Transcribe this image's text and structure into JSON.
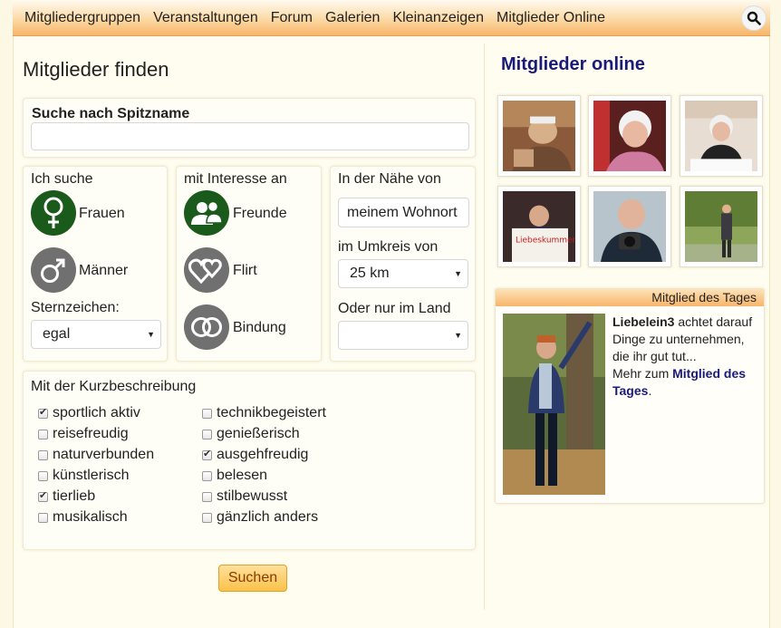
{
  "nav": {
    "items": [
      "Mitgliedergruppen",
      "Veranstaltungen",
      "Forum",
      "Galerien",
      "Kleinanzeigen",
      "Mitglieder Online"
    ],
    "search_icon": "search-icon"
  },
  "main": {
    "title": "Mitglieder finden",
    "nickname": {
      "label": "Suche nach Spitzname",
      "value": ""
    },
    "seeking": {
      "label": "Ich suche",
      "options": [
        {
          "label": "Frauen",
          "icon": "female-symbol-icon",
          "selected": true
        },
        {
          "label": "Männer",
          "icon": "male-symbol-icon",
          "selected": false
        }
      ],
      "zodiac_label": "Sternzeichen:",
      "zodiac_value": "egal"
    },
    "interest": {
      "label": "mit Interesse an",
      "options": [
        {
          "label": "Freunde",
          "icon": "people-icon",
          "selected": true
        },
        {
          "label": "Flirt",
          "icon": "hearts-icon",
          "selected": false
        },
        {
          "label": "Bindung",
          "icon": "rings-icon",
          "selected": false
        }
      ]
    },
    "location": {
      "near_label": "In der Nähe von",
      "near_value": "meinem Wohnort",
      "radius_label": "im Umkreis von",
      "radius_value": "25 km",
      "country_label": "Oder nur im Land",
      "country_value": ""
    },
    "description": {
      "label": "Mit der Kurzbeschreibung",
      "col1": [
        {
          "label": "sportlich aktiv",
          "checked": true
        },
        {
          "label": "reisefreudig",
          "checked": false
        },
        {
          "label": "naturverbunden",
          "checked": false
        },
        {
          "label": "künstlerisch",
          "checked": false
        },
        {
          "label": "tierlieb",
          "checked": true
        },
        {
          "label": "musikalisch",
          "checked": false
        }
      ],
      "col2": [
        {
          "label": "technikbegeistert",
          "checked": false
        },
        {
          "label": "genießerisch",
          "checked": false
        },
        {
          "label": "ausgehfreudig",
          "checked": true
        },
        {
          "label": "belesen",
          "checked": false
        },
        {
          "label": "stilbewusst",
          "checked": false
        },
        {
          "label": "gänzlich anders",
          "checked": false
        }
      ]
    },
    "search_button": "Suchen"
  },
  "sidebar": {
    "online_title": "Mitglieder online",
    "member_of_day": {
      "bar_label": "Mitglied des Tages",
      "nickname": "Liebelein3",
      "text": " achtet darauf Dinge zu unternehmen, die ihr gut tut...",
      "more_prefix": "Mehr zum ",
      "more_link": "Mitglied des Tages",
      "more_suffix": "."
    },
    "thumb_sign_text": "Liebeskummer Dilbe"
  },
  "colors": {
    "accent_orange": "#f7b56a",
    "selected_green": "#1a5a1a",
    "unselected_gray": "#707070",
    "link_blue": "#1a1a7a"
  }
}
